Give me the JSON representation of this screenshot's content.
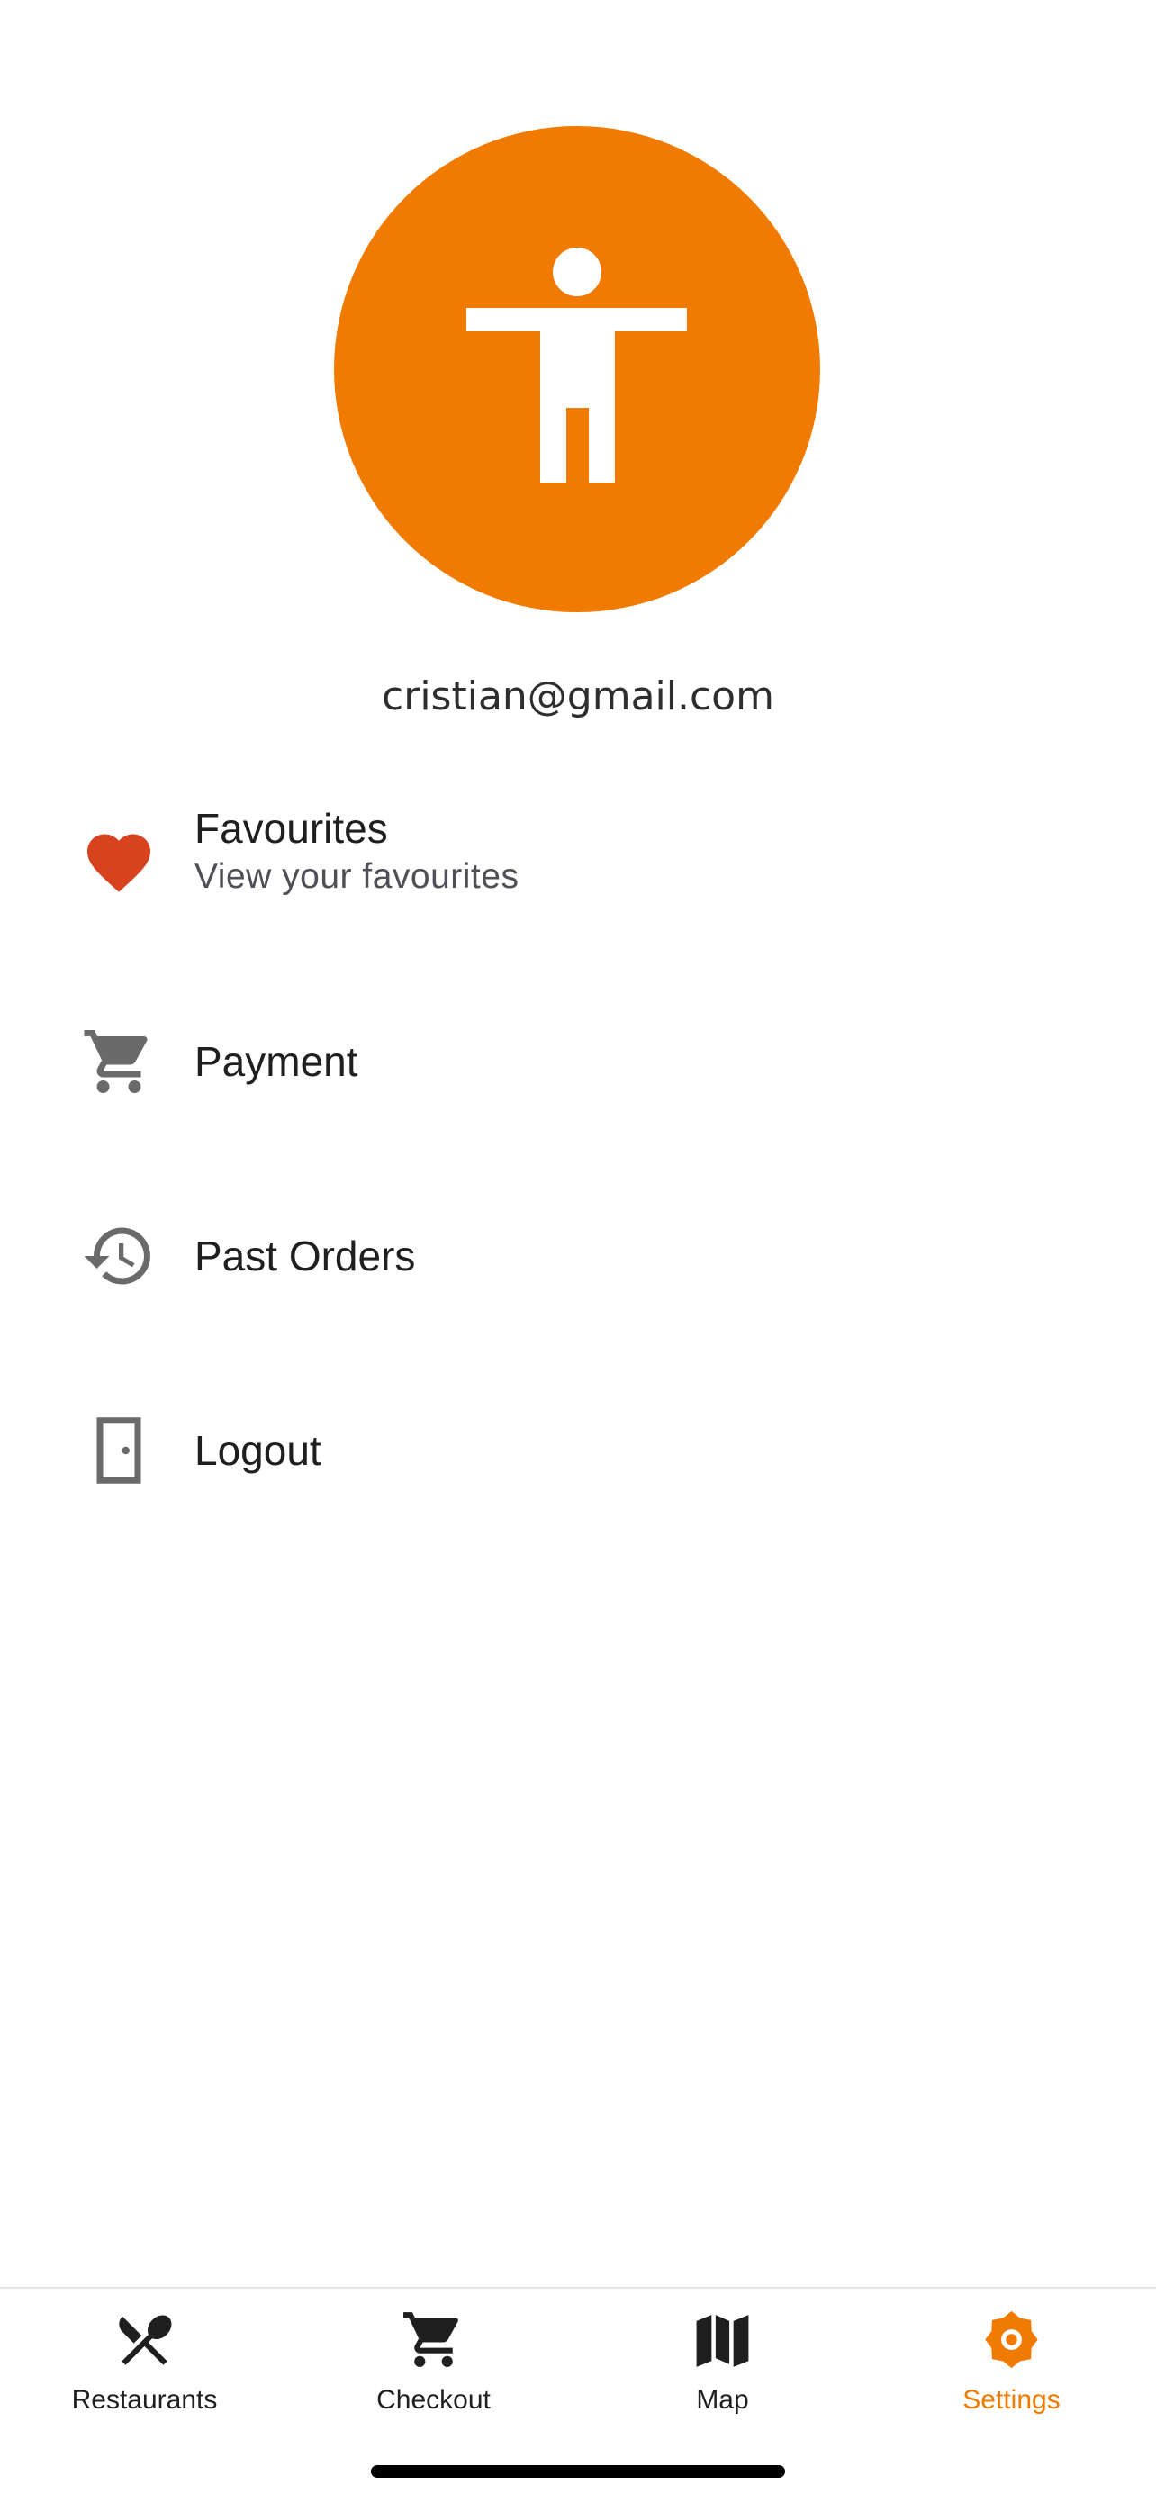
{
  "profile": {
    "email": "cristian@gmail.com",
    "avatar_icon": "accessibility-person-icon",
    "avatar_color": "#f07b00"
  },
  "menu": {
    "items": [
      {
        "title": "Favourites",
        "subtitle": "View your favourites",
        "icon": "heart-icon",
        "icon_color": "#d8431f"
      },
      {
        "title": "Payment",
        "icon": "cart-icon",
        "icon_color": "#6a6a6a"
      },
      {
        "title": "Past Orders",
        "icon": "history-icon",
        "icon_color": "#6a6a6a"
      },
      {
        "title": "Logout",
        "icon": "door-icon",
        "icon_color": "#6a6a6a"
      }
    ]
  },
  "tabbar": {
    "active_color": "#f07b00",
    "inactive_color": "#1f1f1f",
    "tabs": [
      {
        "label": "Restaurants",
        "icon": "fork-knife-icon",
        "active": false
      },
      {
        "label": "Checkout",
        "icon": "cart-icon",
        "active": false
      },
      {
        "label": "Map",
        "icon": "map-icon",
        "active": false
      },
      {
        "label": "Settings",
        "icon": "gear-icon",
        "active": true
      }
    ]
  }
}
